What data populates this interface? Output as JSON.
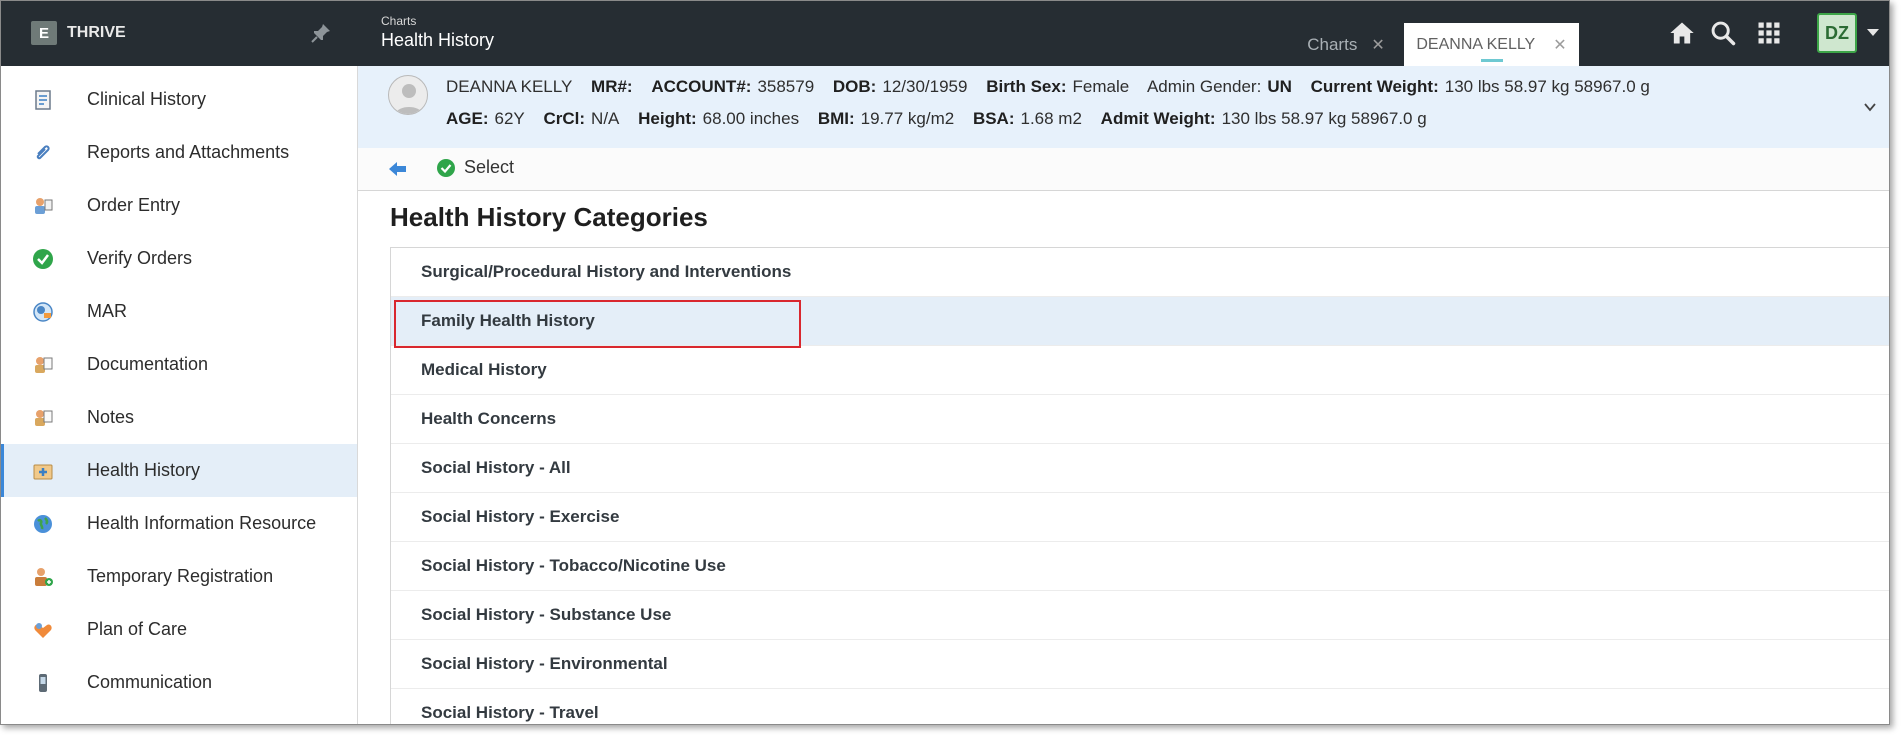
{
  "app": {
    "brand": "THRIVE"
  },
  "header": {
    "breadcrumb_small": "Charts",
    "breadcrumb_title": "Health History",
    "tabs": [
      {
        "label": "Charts",
        "active": false
      },
      {
        "label": "DEANNA KELLY",
        "active": true
      }
    ],
    "user_initials": "DZ"
  },
  "sidebar": {
    "items": [
      {
        "label": "Clinical History",
        "icon": "clinical-history-icon",
        "active": false
      },
      {
        "label": "Reports and Attachments",
        "icon": "paperclip-icon",
        "active": false
      },
      {
        "label": "Order Entry",
        "icon": "order-entry-icon",
        "active": false
      },
      {
        "label": "Verify Orders",
        "icon": "green-check-icon",
        "active": false
      },
      {
        "label": "MAR",
        "icon": "mar-icon",
        "active": false
      },
      {
        "label": "Documentation",
        "icon": "documentation-icon",
        "active": false
      },
      {
        "label": "Notes",
        "icon": "notes-icon",
        "active": false
      },
      {
        "label": "Health History",
        "icon": "health-history-icon",
        "active": true
      },
      {
        "label": "Health Information Resource",
        "icon": "globe-icon",
        "active": false
      },
      {
        "label": "Temporary Registration",
        "icon": "person-add-icon",
        "active": false
      },
      {
        "label": "Plan of Care",
        "icon": "plan-of-care-icon",
        "active": false
      },
      {
        "label": "Communication",
        "icon": "phone-icon",
        "active": false
      }
    ]
  },
  "patient": {
    "name": "DEANNA KELLY",
    "mr_label": "MR#:",
    "account_label": "ACCOUNT#:",
    "account_value": "358579",
    "dob_label": "DOB:",
    "dob_value": "12/30/1959",
    "birth_sex_label": "Birth Sex:",
    "birth_sex_value": "Female",
    "admin_gender_label": "Admin Gender:",
    "admin_gender_value": "UN",
    "current_weight_label": "Current Weight:",
    "current_weight_value": "130 lbs 58.97 kg 58967.0 g",
    "age_label": "AGE:",
    "age_value": "62Y",
    "crcl_label": "CrCl:",
    "crcl_value": "N/A",
    "height_label": "Height:",
    "height_value": "68.00 inches",
    "bmi_label": "BMI:",
    "bmi_value": "19.77 kg/m2",
    "bsa_label": "BSA:",
    "bsa_value": "1.68 m2",
    "admit_weight_label": "Admit Weight:",
    "admit_weight_value": "130 lbs 58.97 kg 58967.0 g"
  },
  "toolbar": {
    "select_label": "Select"
  },
  "main": {
    "title": "Health History Categories",
    "categories": [
      "Surgical/Procedural History and Interventions",
      "Family Health History",
      "Medical History",
      "Health Concerns",
      "Social History - All",
      "Social History - Exercise",
      "Social History - Tobacco/Nicotine Use",
      "Social History - Substance Use",
      "Social History - Environmental",
      "Social History - Travel"
    ],
    "selected_index": 1
  },
  "colors": {
    "topbar": "#262d33",
    "active_bg": "#e4eef8",
    "accent_blue": "#3b87d8",
    "highlight_red": "#d9272e",
    "avatar_green": "#3da548"
  }
}
